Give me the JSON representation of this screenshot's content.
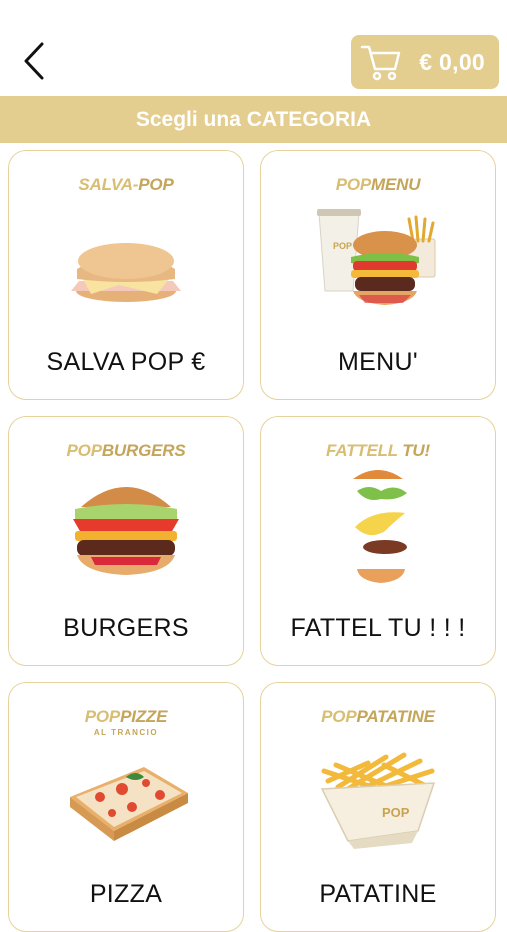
{
  "header": {
    "back_icon": "chevron-left-icon",
    "cart_icon": "shopping-cart-icon",
    "cart_total": "€ 0,00"
  },
  "category_bar": {
    "title": "Scegli una CATEGORIA"
  },
  "categories": [
    {
      "brand_a": "SALVA-",
      "brand_b": "POP",
      "brand_sub": "",
      "label": "SALVA POP €"
    },
    {
      "brand_a": "POP",
      "brand_b": "MENU",
      "brand_sub": "",
      "label": "MENU'"
    },
    {
      "brand_a": "POP",
      "brand_b": "BURGERS",
      "brand_sub": "",
      "label": "BURGERS"
    },
    {
      "brand_a": "FATTELL ",
      "brand_b": "TU!",
      "brand_sub": "",
      "label": "FATTEL TU ! ! !"
    },
    {
      "brand_a": "POP",
      "brand_b": "PIZZE",
      "brand_sub": "AL TRANCIO",
      "label": "PIZZA"
    },
    {
      "brand_a": "POP",
      "brand_b": "PATATINE",
      "brand_sub": "",
      "label": "PATATINE"
    }
  ],
  "colors": {
    "accent": "#e3cd8f",
    "card_border": "#e6d39c",
    "brand_text": "#d8bd72"
  }
}
